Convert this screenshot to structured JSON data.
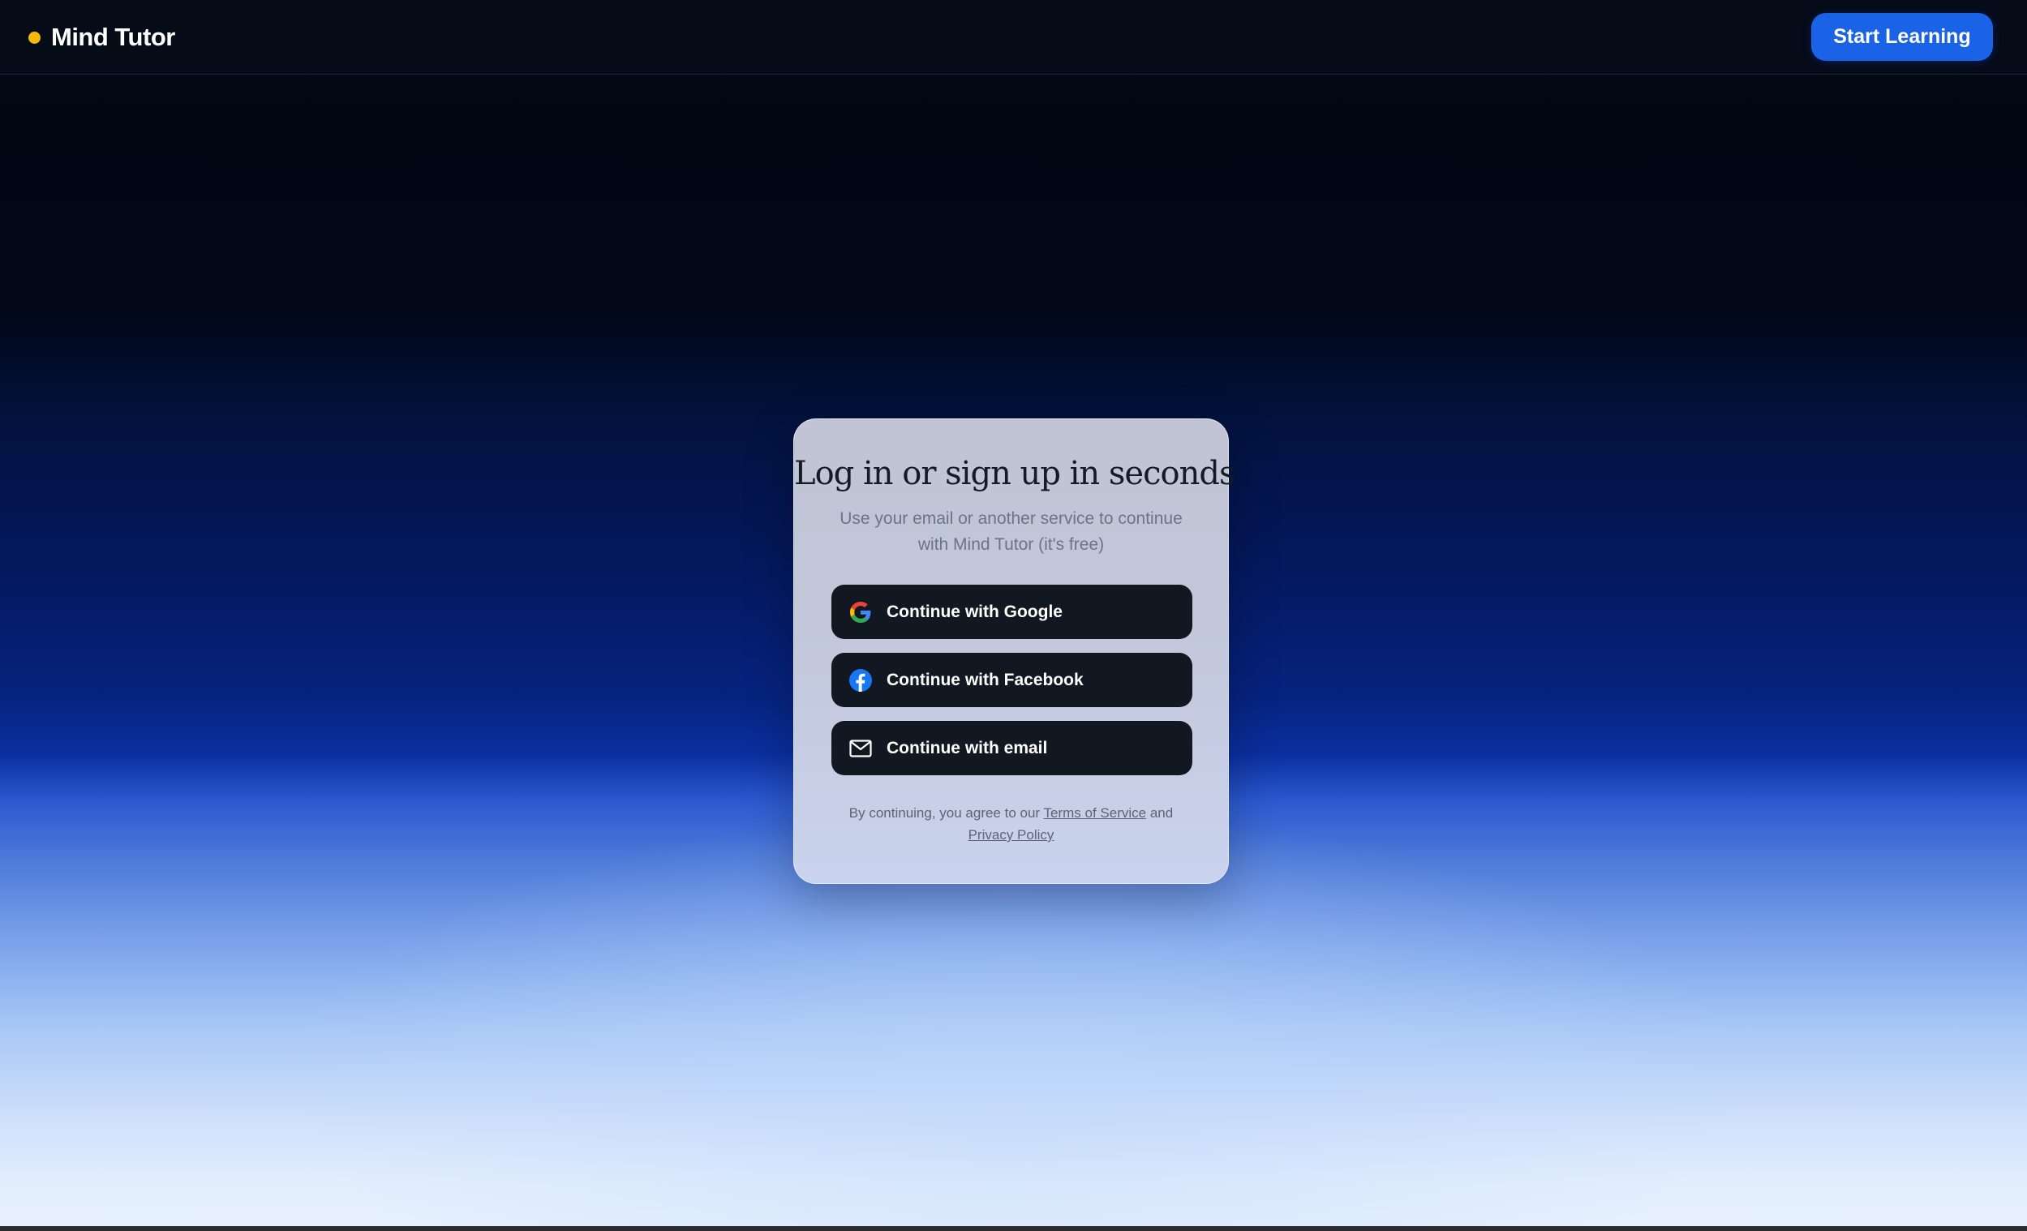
{
  "header": {
    "brand_name": "Mind Tutor",
    "cta_label": "Start Learning"
  },
  "auth_card": {
    "title": "Log in or sign up in seconds",
    "subtitle": "Use your email or another service to continue with Mind Tutor (it's free)",
    "buttons": [
      {
        "label": "Continue with Google",
        "icon": "google-icon"
      },
      {
        "label": "Continue with Facebook",
        "icon": "facebook-icon"
      },
      {
        "label": "Continue with email",
        "icon": "mail-icon"
      }
    ],
    "legal": {
      "prefix": "By continuing, you agree to our",
      "terms_link": "Terms of Service",
      "conjunction": "and",
      "privacy_link": "Privacy Policy"
    }
  },
  "colors": {
    "brand_dot": "#f5b90a",
    "cta_background": "#1b63e6",
    "button_background": "#121821",
    "facebook_blue": "#1877f2"
  }
}
